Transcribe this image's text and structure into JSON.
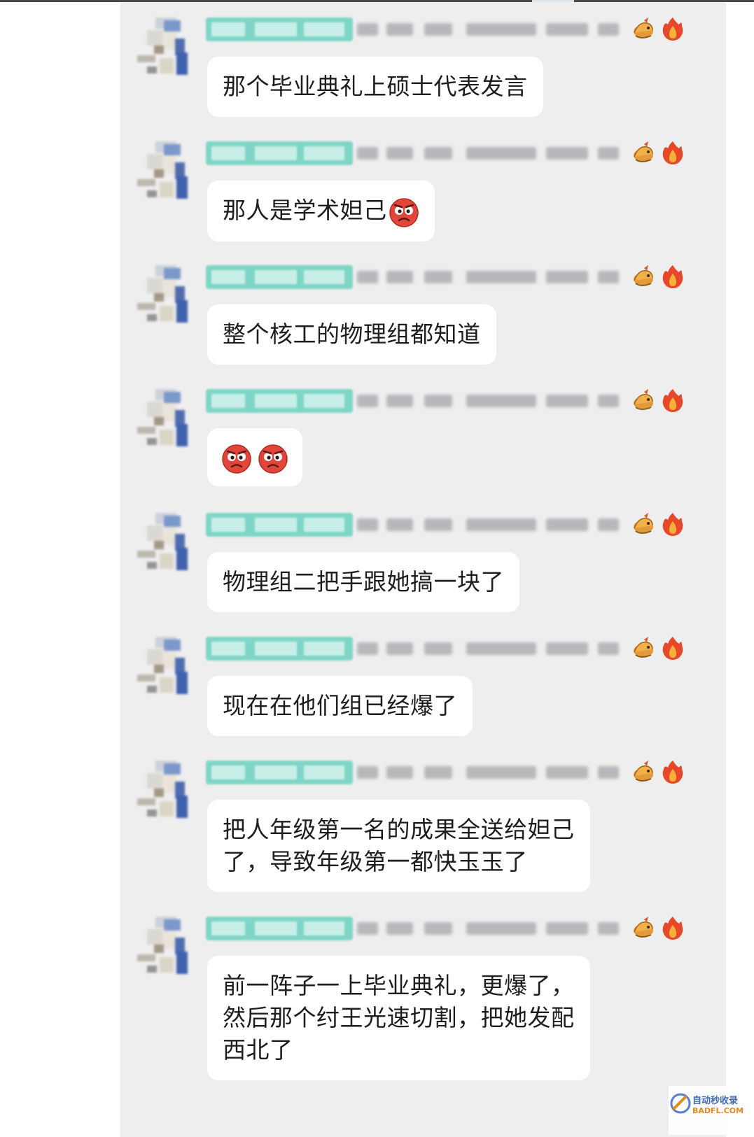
{
  "chat": {
    "messages": [
      {
        "text": "那个毕业典礼上硕士代表发言",
        "emoji_after": 0
      },
      {
        "text": "那人是学术妲己",
        "emoji_after": 1
      },
      {
        "text": "整个核工的物理组都知道",
        "emoji_after": 0
      },
      {
        "text": "",
        "emoji_after": 2
      },
      {
        "text": "物理组二把手跟她搞一块了",
        "emoji_after": 0
      },
      {
        "text": "现在在他们组已经爆了",
        "emoji_after": 0
      },
      {
        "text_lines": [
          "把人年级第一名的成果全送给妲己",
          "了，导致年级第一都快玉玉了"
        ],
        "emoji_after": 0
      },
      {
        "text_lines": [
          "前一阵子一上毕业典礼，更爆了，",
          "然后那个纣王光速切割，把她发配",
          "西北了"
        ],
        "emoji_after": 0
      }
    ],
    "sender_badges": [
      "dragon-icon",
      "fire-icon"
    ],
    "emoji_name": "angry-face-emoji"
  },
  "watermark": {
    "line1": "自动秒收录",
    "line2": "BADFL.COM"
  },
  "colors": {
    "panel_bg": "#eeeeef",
    "bubble_bg": "#ffffff",
    "tag_bg": "#7fd6c6",
    "text": "#1e1e1e"
  }
}
